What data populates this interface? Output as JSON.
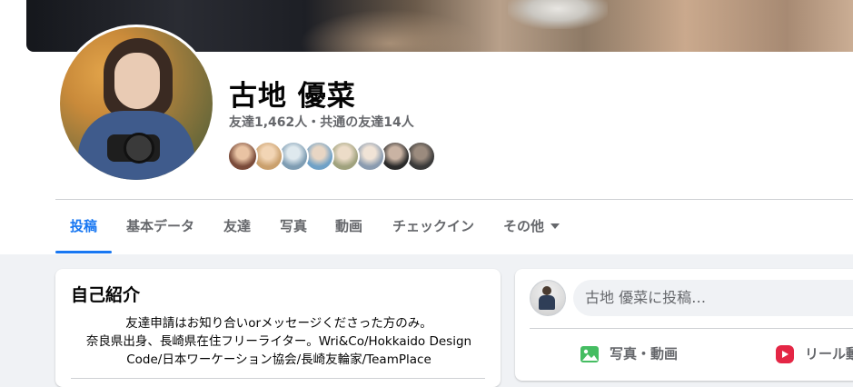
{
  "profile": {
    "name": "古地 優菜",
    "friends_summary": "友達1,462人・共通の友達14人",
    "mutual_friend_avatars": [
      {
        "color_a": "#7a4b3a",
        "color_b": "#e9c3a3"
      },
      {
        "color_a": "#caa06d",
        "color_b": "#f2d5b5"
      },
      {
        "color_a": "#7f9db3",
        "color_b": "#dfe9ee"
      },
      {
        "color_a": "#6fa1c7",
        "color_b": "#e8d6c4"
      },
      {
        "color_a": "#a0a27e",
        "color_b": "#ecdcc8"
      },
      {
        "color_a": "#8a9bb0",
        "color_b": "#f0e3d6"
      },
      {
        "color_a": "#2b2b2b",
        "color_b": "#c9b3a3"
      },
      {
        "color_a": "#3a3a3a",
        "color_b": "#9b8b7e"
      }
    ]
  },
  "tabs": [
    {
      "label": "投稿",
      "active": true
    },
    {
      "label": "基本データ",
      "active": false
    },
    {
      "label": "友達",
      "active": false
    },
    {
      "label": "写真",
      "active": false
    },
    {
      "label": "動画",
      "active": false
    },
    {
      "label": "チェックイン",
      "active": false
    },
    {
      "label": "その他",
      "active": false,
      "has_dropdown": true
    }
  ],
  "intro": {
    "title": "自己紹介",
    "bio_lines": [
      "友達申請はお知り合いorメッセージくださった方のみ。",
      "奈良県出身、長崎県在住フリーライター。Wri&Co/Hokkaido Design",
      "Code/日本ワーケーション協会/長崎友輪家/TeamPlace"
    ]
  },
  "composer": {
    "placeholder": "古地 優菜に投稿…",
    "actions": [
      {
        "label": "写真・動画",
        "icon": "photo-video-icon",
        "color": "#45bd62"
      },
      {
        "label": "リール動画",
        "icon": "reels-icon",
        "color": "#e42645"
      }
    ]
  },
  "colors": {
    "accent": "#1877f2",
    "secondary_text": "#65676b",
    "page_bg": "#f0f2f5"
  }
}
